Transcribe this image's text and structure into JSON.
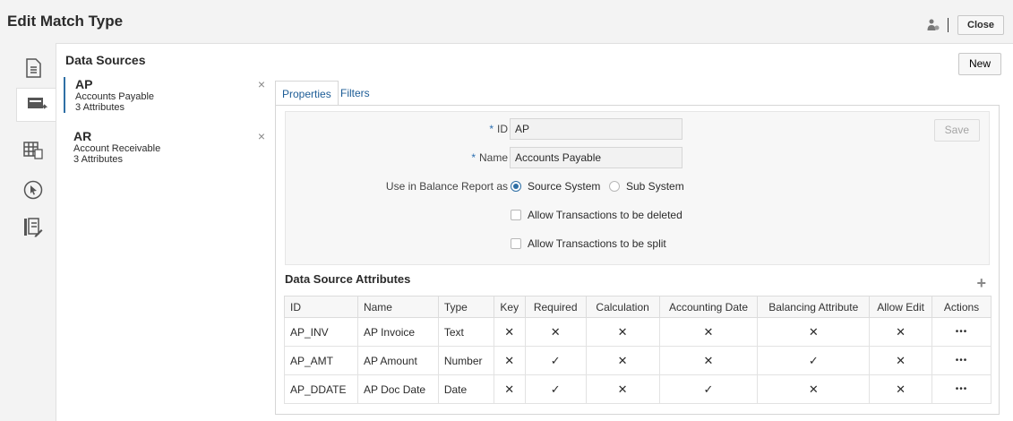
{
  "header": {
    "title": "Edit Match Type",
    "close_label": "Close"
  },
  "data_sources": {
    "title": "Data Sources",
    "new_label": "New",
    "items": [
      {
        "code": "AP",
        "name": "Accounts Payable",
        "attributes": "3 Attributes",
        "remove": "×"
      },
      {
        "code": "AR",
        "name": "Account Receivable",
        "attributes": "3 Attributes",
        "remove": "×"
      }
    ]
  },
  "tabs": [
    {
      "label": "Properties"
    },
    {
      "label": "Filters"
    }
  ],
  "form": {
    "required_mark": "*",
    "id_label": "ID",
    "id_value": "AP",
    "name_label": "Name",
    "name_value": "Accounts Payable",
    "balance_label": "Use in Balance Report as",
    "option_source": "Source System",
    "option_sub": "Sub System",
    "selected_option": "Source System",
    "allow_delete": "Allow Transactions to be deleted",
    "allow_split": "Allow Transactions to be split",
    "save_label": "Save"
  },
  "attributes": {
    "title": "Data Source Attributes",
    "add": "+",
    "columns": [
      "ID",
      "Name",
      "Type",
      "Key",
      "Required",
      "Calculation",
      "Accounting Date",
      "Balancing Attribute",
      "Allow Edit",
      "Actions"
    ],
    "rows": [
      {
        "id": "AP_INV",
        "name": "AP Invoice",
        "type": "Text",
        "key": "✕",
        "required": "✕",
        "calculation": "✕",
        "accounting_date": "✕",
        "balancing": "✕",
        "allow_edit": "✕",
        "actions": "•••"
      },
      {
        "id": "AP_AMT",
        "name": "AP Amount",
        "type": "Number",
        "key": "✕",
        "required": "✓",
        "calculation": "✕",
        "accounting_date": "✕",
        "balancing": "✓",
        "allow_edit": "✕",
        "actions": "•••"
      },
      {
        "id": "AP_DDATE",
        "name": "AP Doc Date",
        "type": "Date",
        "key": "✕",
        "required": "✓",
        "calculation": "✕",
        "accounting_date": "✓",
        "balancing": "✕",
        "allow_edit": "✕",
        "actions": "•••"
      }
    ]
  },
  "nav": [
    "document-list-icon",
    "data-source-icon",
    "table-icon",
    "cursor-icon",
    "edit-list-icon"
  ]
}
